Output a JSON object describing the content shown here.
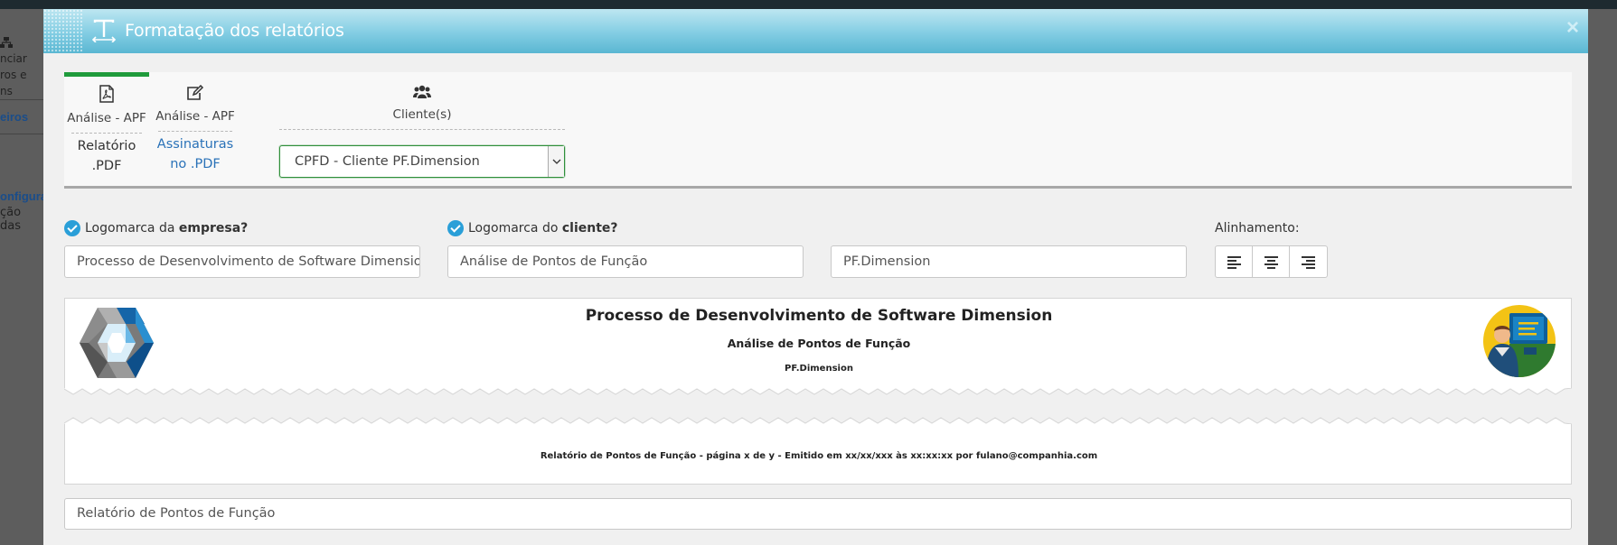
{
  "background": {
    "side_items": [
      "nciar",
      "ros e",
      "ns"
    ],
    "side_link": "eiros",
    "side_link2": "onfigura",
    "side_text": "ção das"
  },
  "modal": {
    "title": "Formatação dos relatórios",
    "close_label": "×",
    "header_icon": "text-format-icon"
  },
  "tabs": [
    {
      "icon": "pdf-icon",
      "sub": "Análise - APF",
      "main_1": "Relatório",
      "main_2": ".PDF",
      "active": true
    },
    {
      "icon": "edit-icon",
      "sub": "Análise - APF",
      "main_1": "Assinaturas",
      "main_2": "no .PDF",
      "active": false
    },
    {
      "icon": "users-icon",
      "sub": "Cliente(s)",
      "active": false
    }
  ],
  "client_select": {
    "value": "CPFD - Cliente PF.Dimension"
  },
  "options": {
    "company_logo_prefix": "Logomarca da ",
    "company_logo_bold": "empresa?",
    "client_logo_prefix": "Logomarca do ",
    "client_logo_bold": "cliente?",
    "alignment_label": "Alinhamento:"
  },
  "inputs": {
    "line1": "Processo de Desenvolvimento de Software Dimension",
    "line2": "Análise de Pontos de Função",
    "line3": "PF.Dimension",
    "footer_title": "Relatório de Pontos de Função"
  },
  "alignment_buttons": [
    "align-left-icon",
    "align-center-icon",
    "align-right-icon"
  ],
  "preview": {
    "title1": "Processo de Desenvolvimento de Software Dimension",
    "title2": "Análise de Pontos de Função",
    "title3": "PF.Dimension",
    "footer": "Relatório de Pontos de Função - página x de y - Emitido em xx/xx/xxx às xx:xx:xx por fulano@companhia.com"
  },
  "colors": {
    "header_top": "#bde6f1",
    "header_bottom": "#5ab7d2",
    "active_tab": "#1f9b3b",
    "link_blue": "#2a72b8",
    "check_blue": "#2a9fd8"
  }
}
